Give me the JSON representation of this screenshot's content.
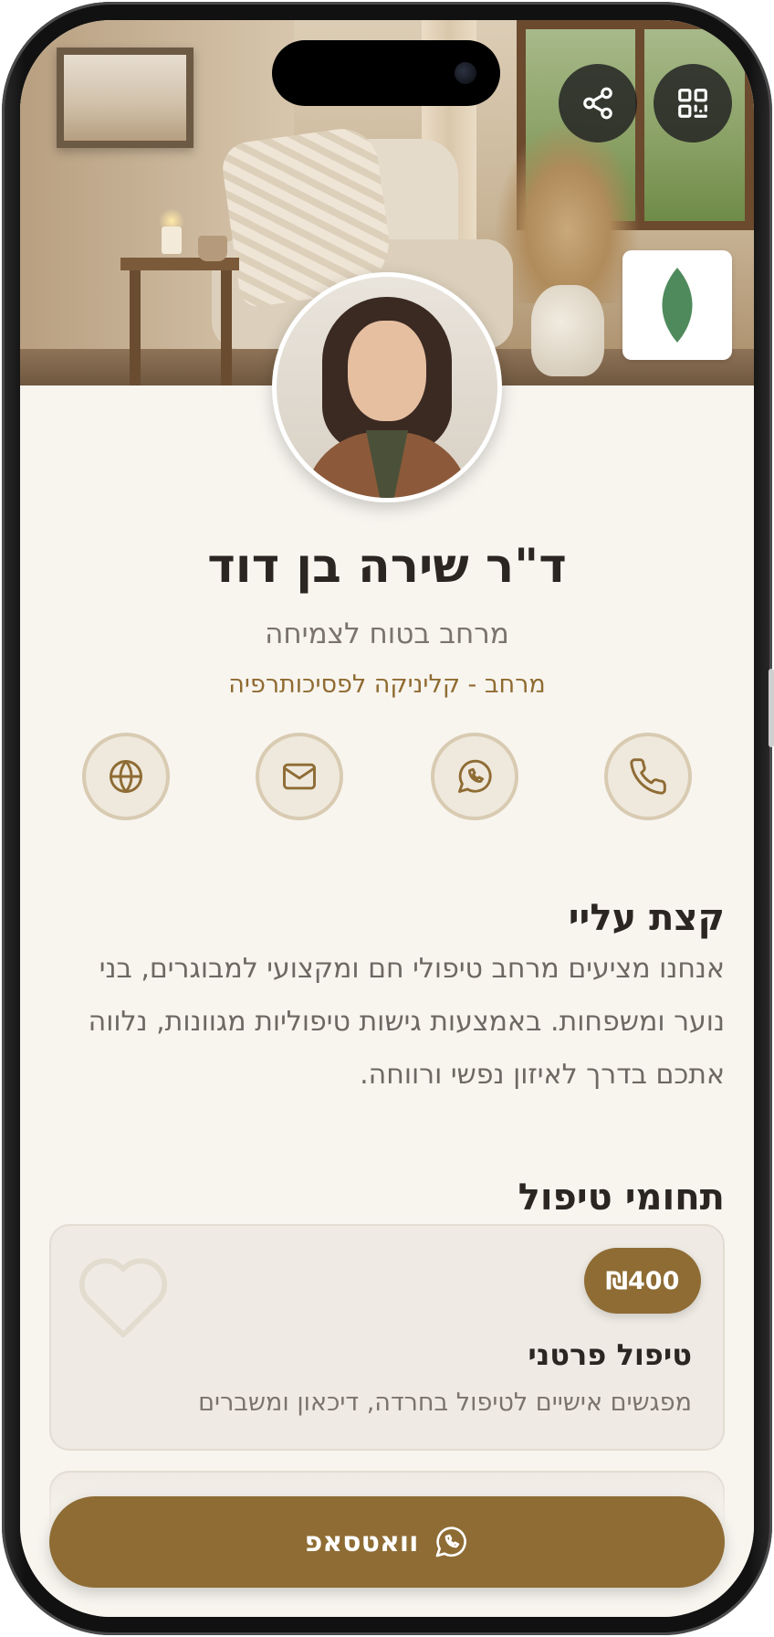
{
  "profile": {
    "name": "ד\"ר שירה בן דוד",
    "tagline": "מרחב בטוח לצמיחה",
    "clinic": "מרחב - קליניקה לפסיכותרפיה"
  },
  "header": {
    "share_icon": "share-icon",
    "qr_icon": "qr-code-icon",
    "logo_icon": "leaf-icon"
  },
  "contacts": [
    {
      "id": "phone",
      "icon": "phone-icon"
    },
    {
      "id": "whatsapp",
      "icon": "whatsapp-icon"
    },
    {
      "id": "email",
      "icon": "mail-icon"
    },
    {
      "id": "website",
      "icon": "globe-icon"
    }
  ],
  "about": {
    "title": "קצת עליי",
    "text": "אנחנו מציעים מרחב טיפולי חם ומקצועי למבוגרים, בני נוער ומשפחות. באמצעות גישות טיפוליות מגוונות, נלווה אתכם בדרך לאיזון נפשי ורווחה."
  },
  "services": {
    "title": "תחומי טיפול",
    "items": [
      {
        "price": "₪400",
        "title": "טיפול פרטני",
        "description": "מפגשים אישיים לטיפול בחרדה, דיכאון ומשברים"
      }
    ]
  },
  "cta": {
    "label": "וואטסאפ"
  },
  "colors": {
    "accent": "#8e6c34",
    "background": "#f8f5ef",
    "logo_leaf": "#4f8a5c"
  }
}
